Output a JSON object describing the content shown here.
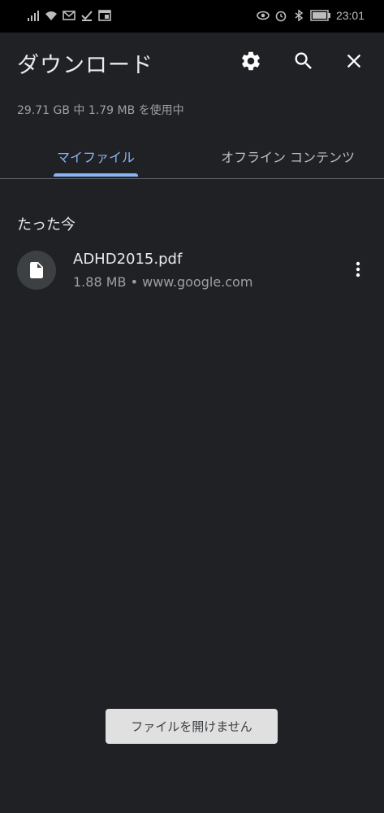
{
  "status_bar": {
    "time": "23:01",
    "left_icons": [
      "signal-icon",
      "wifi-icon",
      "mail-icon",
      "download-done-icon",
      "window-icon"
    ],
    "right_icons": [
      "eye-icon",
      "alarm-icon",
      "bluetooth-icon",
      "battery-icon"
    ]
  },
  "header": {
    "title": "ダウンロード",
    "actions": [
      "gear-icon",
      "search-icon",
      "close-icon"
    ]
  },
  "storage": {
    "text": "29.71 GB 中 1.79 MB を使用中"
  },
  "tabs": [
    {
      "label": "マイファイル",
      "active": true
    },
    {
      "label": "オフライン コンテンツ",
      "active": false
    }
  ],
  "colors": {
    "background": "#202124",
    "accent": "#8ab4f8",
    "status_bar": "#000000",
    "toast_bg": "#e0e0e0"
  },
  "section": {
    "label": "たった今"
  },
  "files": [
    {
      "name": "ADHD2015.pdf",
      "meta": "1.88 MB • www.google.com",
      "icon": "file-icon"
    }
  ],
  "toast": {
    "text": "ファイルを開けません"
  }
}
